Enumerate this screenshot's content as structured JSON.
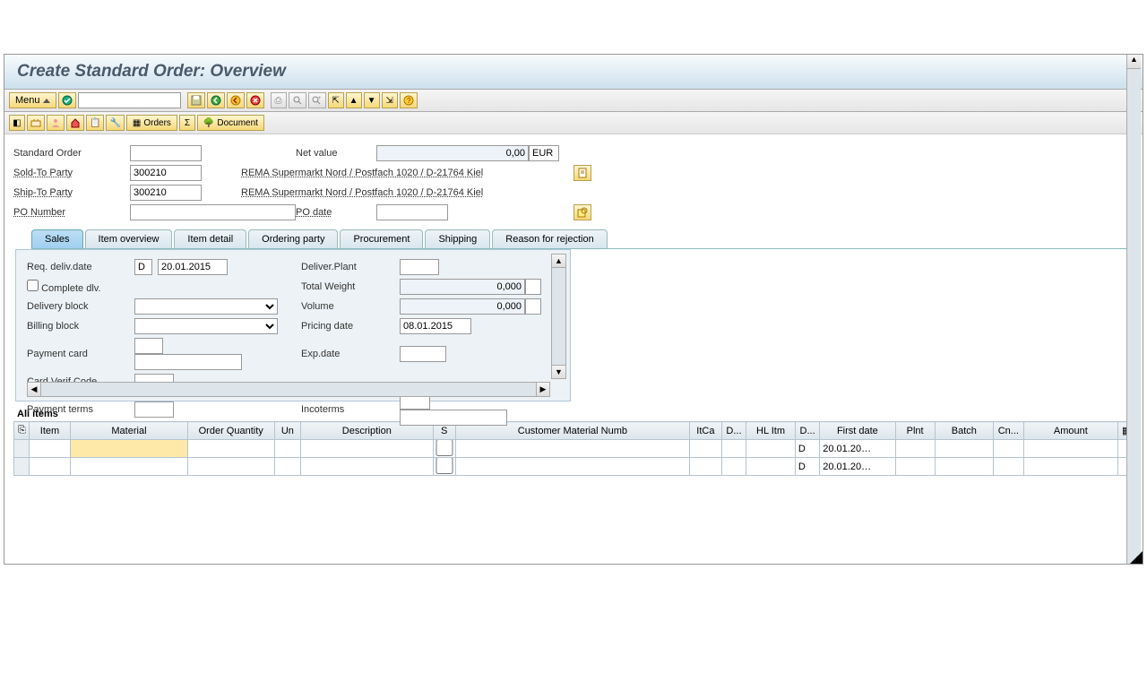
{
  "title": "Create Standard Order: Overview",
  "menu_label": "Menu",
  "toolbar2": {
    "orders": "Orders",
    "document": "Document"
  },
  "header": {
    "std_order_lbl": "Standard Order",
    "std_order_val": "",
    "net_value_lbl": "Net value",
    "net_value_val": "0,00",
    "currency": "EUR",
    "sold_to_lbl": "Sold-To Party",
    "sold_to_val": "300210",
    "sold_to_desc": "REMA Supermarkt Nord / Postfach 1020 / D-21764 Kiel",
    "ship_to_lbl": "Ship-To Party",
    "ship_to_val": "300210",
    "ship_to_desc": "REMA Supermarkt Nord / Postfach 1020 / D-21764 Kiel",
    "po_lbl": "PO Number",
    "po_val": "",
    "po_date_lbl": "PO date",
    "po_date_val": ""
  },
  "tabs": [
    "Sales",
    "Item overview",
    "Item detail",
    "Ordering party",
    "Procurement",
    "Shipping",
    "Reason for rejection"
  ],
  "sales": {
    "req_date_lbl": "Req. deliv.date",
    "req_date_type": "D",
    "req_date_val": "20.01.2015",
    "deliver_plant_lbl": "Deliver.Plant",
    "deliver_plant_val": "",
    "complete_dlv_lbl": "Complete dlv.",
    "total_weight_lbl": "Total Weight",
    "total_weight_val": "0,000",
    "delivery_block_lbl": "Delivery block",
    "volume_lbl": "Volume",
    "volume_val": "0,000",
    "billing_block_lbl": "Billing block",
    "pricing_date_lbl": "Pricing date",
    "pricing_date_val": "08.01.2015",
    "payment_card_lbl": "Payment card",
    "exp_date_lbl": "Exp.date",
    "card_verif_lbl": "Card Verif.Code",
    "payment_terms_lbl": "Payment terms",
    "incoterms_lbl": "Incoterms"
  },
  "items_title": "All items",
  "items_cols": {
    "item": "Item",
    "material": "Material",
    "qty": "Order Quantity",
    "un": "Un",
    "desc": "Description",
    "s": "S",
    "custmat": "Customer Material Numb",
    "itca": "ItCa",
    "d1": "D...",
    "hlitm": "HL Itm",
    "d2": "D...",
    "first": "First date",
    "plnt": "Plnt",
    "batch": "Batch",
    "cn": "Cn...",
    "amount": "Amount"
  },
  "items_rows": [
    {
      "d2": "D",
      "first": "20.01.20…"
    },
    {
      "d2": "D",
      "first": "20.01.20…"
    }
  ]
}
